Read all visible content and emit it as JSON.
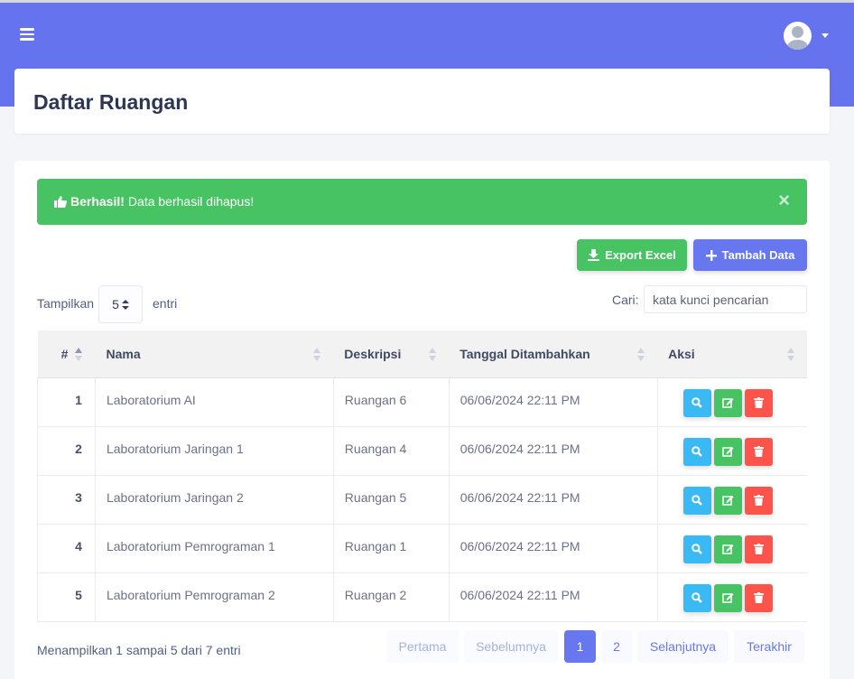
{
  "header": {
    "menu_icon": "hamburger-icon",
    "user_icon": "user-avatar-icon"
  },
  "page": {
    "title": "Daftar Ruangan"
  },
  "alert": {
    "strong": "Berhasil!",
    "message": "Data berhasil dihapus!",
    "close": "×",
    "color": "#47c363"
  },
  "toolbar": {
    "export_label": "Export Excel",
    "add_label": "Tambah Data",
    "export_color": "#47c363",
    "add_color": "#6777ef"
  },
  "length": {
    "prefix": "Tampilkan",
    "value": "5",
    "suffix": "entri"
  },
  "search": {
    "label": "Cari:",
    "placeholder": "kata kunci pencarian"
  },
  "table": {
    "columns": [
      "#",
      "Nama",
      "Deskripsi",
      "Tanggal Ditambahkan",
      "Aksi"
    ],
    "rows": [
      {
        "no": "1",
        "nama": "Laboratorium AI",
        "deskripsi": "Ruangan 6",
        "tanggal": "06/06/2024 22:11 PM"
      },
      {
        "no": "2",
        "nama": "Laboratorium Jaringan 1",
        "deskripsi": "Ruangan 4",
        "tanggal": "06/06/2024 22:11 PM"
      },
      {
        "no": "3",
        "nama": "Laboratorium Jaringan 2",
        "deskripsi": "Ruangan 5",
        "tanggal": "06/06/2024 22:11 PM"
      },
      {
        "no": "4",
        "nama": "Laboratorium Pemrograman 1",
        "deskripsi": "Ruangan 1",
        "tanggal": "06/06/2024 22:11 PM"
      },
      {
        "no": "5",
        "nama": "Laboratorium Pemrograman 2",
        "deskripsi": "Ruangan 2",
        "tanggal": "06/06/2024 22:11 PM"
      }
    ]
  },
  "info": "Menampilkan 1 sampai 5 dari 7 entri",
  "pagination": {
    "first": "Pertama",
    "prev": "Sebelumnya",
    "pages": [
      "1",
      "2"
    ],
    "next": "Selanjutnya",
    "last": "Terakhir",
    "active_page": "1"
  },
  "colors": {
    "primary": "#6777ef",
    "success": "#47c363",
    "info": "#3abaf4",
    "danger": "#fc544b"
  }
}
